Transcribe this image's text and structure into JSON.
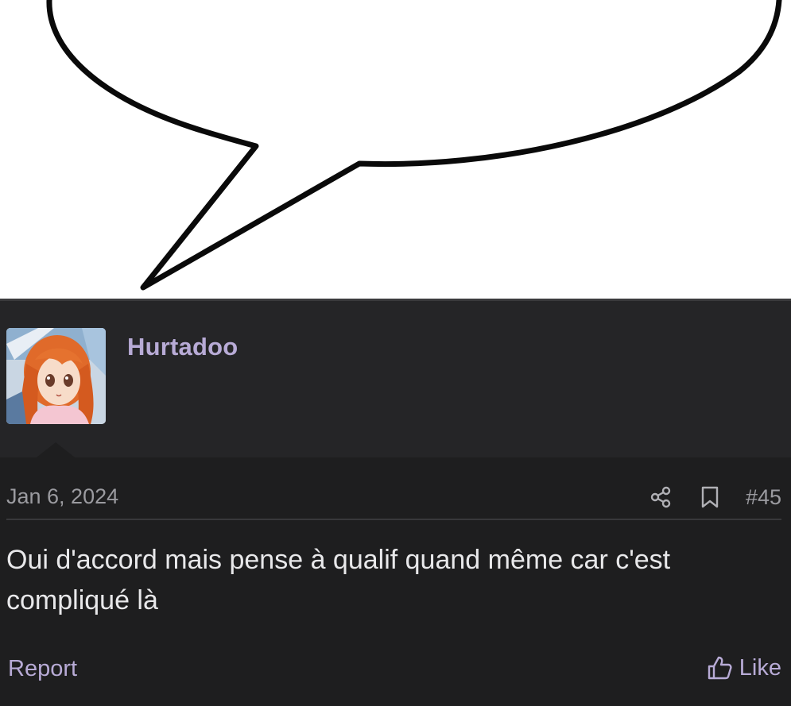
{
  "post": {
    "username": "Hurtadoo",
    "date": "Jan 6, 2024",
    "post_number": "#45",
    "message": "Oui d'accord mais pense à qualif quand même car c'est compliqué là",
    "report_label": "Report",
    "like_label": "Like"
  },
  "icons": {
    "share": "share-icon",
    "bookmark": "bookmark-icon",
    "like": "thumbs-up-icon"
  },
  "colors": {
    "background": "#1e1e1f",
    "header_background": "#252527",
    "accent": "#b8abd6",
    "muted_text": "#9b9ba0",
    "body_text": "#e8e8ea"
  }
}
